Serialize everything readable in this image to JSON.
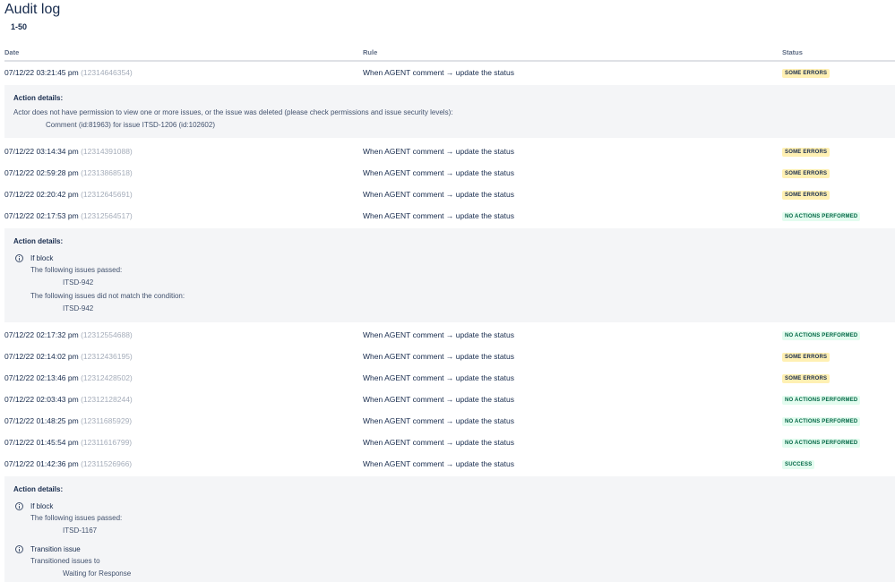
{
  "page": {
    "title": "Audit log",
    "range": "1-50"
  },
  "columns": {
    "date": "Date",
    "rule": "Rule",
    "status": "Status"
  },
  "rows": [
    {
      "date": "07/12/22 03:21:45 pm",
      "id": "(12314646354)",
      "rule": "When AGENT comment → update the status",
      "status": "SOME ERRORS"
    },
    {
      "date": "07/12/22 03:14:34 pm",
      "id": "(12314391088)",
      "rule": "When AGENT comment → update the status",
      "status": "SOME ERRORS"
    },
    {
      "date": "07/12/22 02:59:28 pm",
      "id": "(12313868518)",
      "rule": "When AGENT comment → update the status",
      "status": "SOME ERRORS"
    },
    {
      "date": "07/12/22 02:20:42 pm",
      "id": "(12312645691)",
      "rule": "When AGENT comment → update the status",
      "status": "SOME ERRORS"
    },
    {
      "date": "07/12/22 02:17:53 pm",
      "id": "(12312564517)",
      "rule": "When AGENT comment → update the status",
      "status": "NO ACTIONS PERFORMED"
    },
    {
      "date": "07/12/22 02:17:32 pm",
      "id": "(12312554688)",
      "rule": "When AGENT comment → update the status",
      "status": "NO ACTIONS PERFORMED"
    },
    {
      "date": "07/12/22 02:14:02 pm",
      "id": "(12312436195)",
      "rule": "When AGENT comment → update the status",
      "status": "SOME ERRORS"
    },
    {
      "date": "07/12/22 02:13:46 pm",
      "id": "(12312428502)",
      "rule": "When AGENT comment → update the status",
      "status": "SOME ERRORS"
    },
    {
      "date": "07/12/22 02:03:43 pm",
      "id": "(12312128244)",
      "rule": "When AGENT comment → update the status",
      "status": "NO ACTIONS PERFORMED"
    },
    {
      "date": "07/12/22 01:48:25 pm",
      "id": "(12311685929)",
      "rule": "When AGENT comment → update the status",
      "status": "NO ACTIONS PERFORMED"
    },
    {
      "date": "07/12/22 01:45:54 pm",
      "id": "(12311616799)",
      "rule": "When AGENT comment → update the status",
      "status": "NO ACTIONS PERFORMED"
    },
    {
      "date": "07/12/22 01:42:36 pm",
      "id": "(12311526966)",
      "rule": "When AGENT comment → update the status",
      "status": "SUCCESS"
    }
  ],
  "details": [
    {
      "label": "Action details:",
      "line1": "Actor does not have permission to view one or more issues, or the issue was deleted (please check permissions and issue security levels):",
      "line2": "Comment (id:81963) for issue ITSD-1206 (id:102602)"
    },
    {
      "label": "Action details:",
      "block_title": "If block",
      "passed_label": "The following issues passed:",
      "passed_issue": "ITSD-942",
      "nomatch_label": "The following issues did not match the condition:",
      "nomatch_issue": "ITSD-942"
    },
    {
      "label": "Action details:",
      "block_title": "If block",
      "passed_label": "The following issues passed:",
      "passed_issue": "ITSD-1167",
      "transition_title": "Transition issue",
      "transition_label": "Transitioned issues to",
      "transition_value": "Waiting for Response"
    }
  ],
  "icons": {
    "info": "info-icon"
  },
  "colors": {
    "some_errors_bg": "#fff0b3",
    "no_actions_bg": "#e3fcef",
    "no_actions_fg": "#006644",
    "details_bg": "#f4f5f7"
  }
}
